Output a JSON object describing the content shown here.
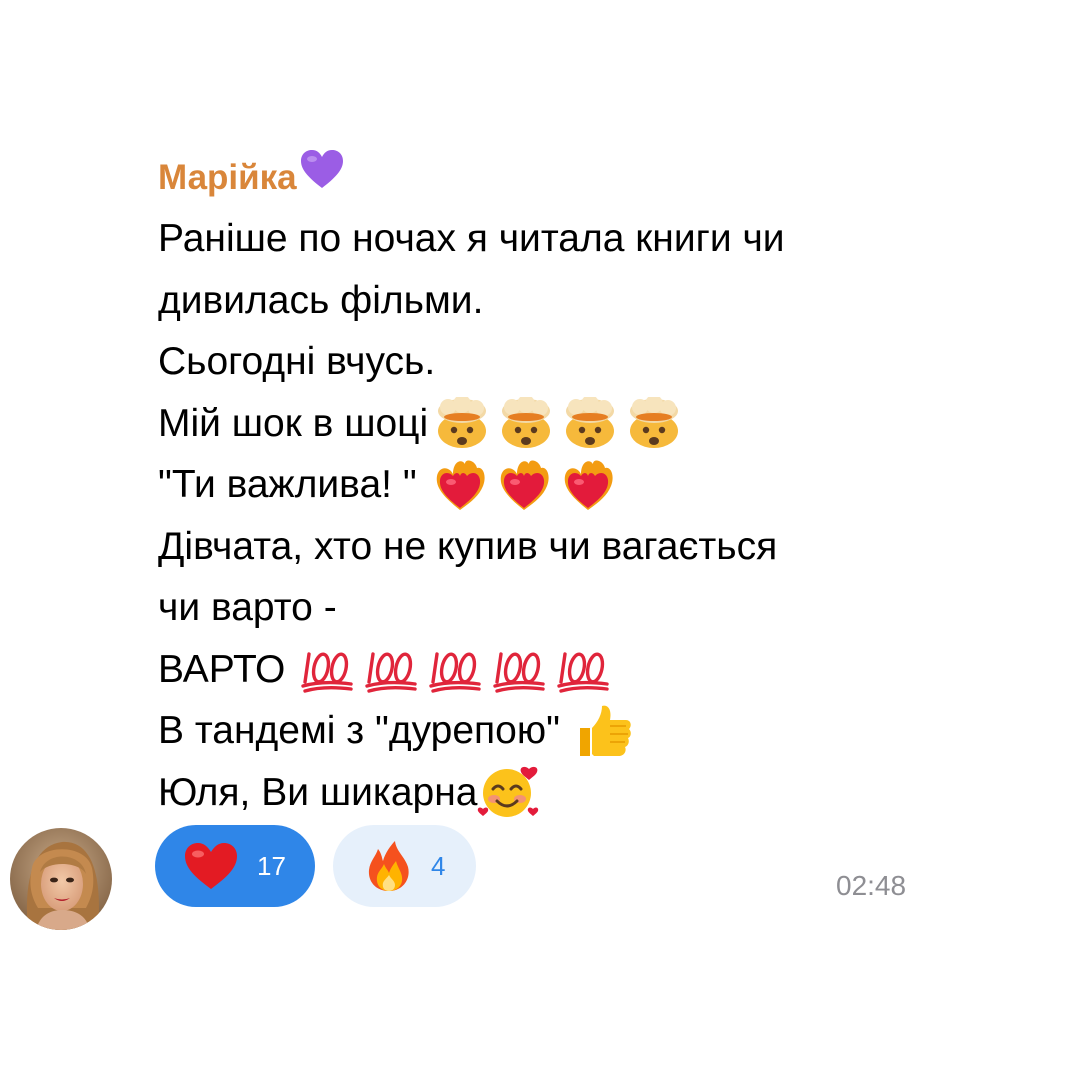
{
  "message": {
    "sender": "Марійка",
    "sender_emoji_icon": "purple-heart-icon",
    "lines": [
      "Раніше по ночах я читала книги чи",
      "дивилась фільми.",
      "Сьогодні вчусь.",
      "Мій шок в шоці",
      "\"Ти важлива! \"",
      "Дівчата, хто не купив чи вагається",
      "чи варто -",
      "ВАРТО",
      "В тандемі з \"дурепою\"",
      "Юля, Ви шикарна"
    ],
    "line_emojis": {
      "shock": "exploding-head-icon",
      "hearts": "heart-on-fire-icon",
      "hundred": "hundred-points-icon",
      "thumbs": "thumbs-up-icon",
      "smile": "smiling-face-with-hearts-icon"
    }
  },
  "reactions": [
    {
      "icon": "red-heart-icon",
      "count": "17",
      "selected": true
    },
    {
      "icon": "fire-icon",
      "count": "4",
      "selected": false
    }
  ],
  "timestamp": "02:48",
  "colors": {
    "sender": "#d9863a",
    "accent": "#2f86e8",
    "reaction_bg": "#e6f0fb",
    "timestamp": "#8e8e93"
  }
}
